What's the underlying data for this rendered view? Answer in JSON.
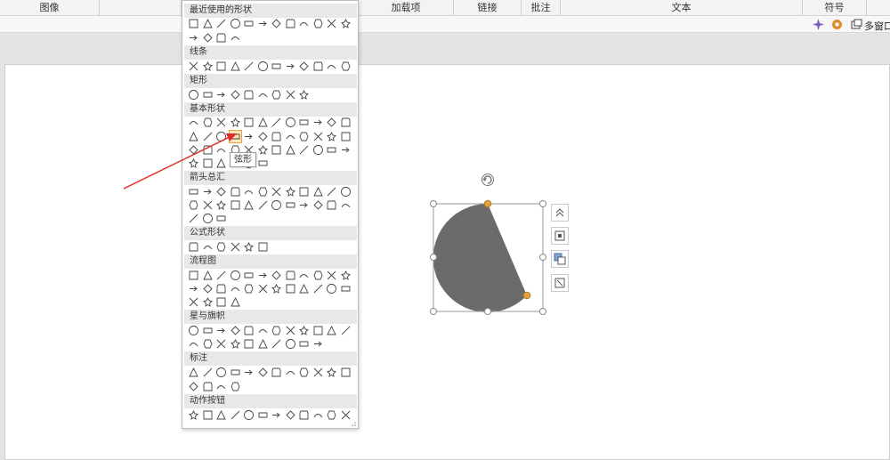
{
  "ribbon": {
    "groups": [
      {
        "id": "image",
        "label": "图像"
      },
      {
        "id": "illust",
        "label": ""
      },
      {
        "id": "addins",
        "label": "加载项"
      },
      {
        "id": "links",
        "label": "链接"
      },
      {
        "id": "comments",
        "label": "批注"
      },
      {
        "id": "text",
        "label": "文本"
      },
      {
        "id": "symbols",
        "label": "符号"
      }
    ],
    "window_label": "多窗口"
  },
  "shapes_panel": {
    "sections": [
      {
        "id": "recent",
        "label": "最近使用的形状"
      },
      {
        "id": "lines",
        "label": "线条"
      },
      {
        "id": "rect",
        "label": "矩形"
      },
      {
        "id": "basic",
        "label": "基本形状"
      },
      {
        "id": "arrows",
        "label": "箭头总汇"
      },
      {
        "id": "equation",
        "label": "公式形状"
      },
      {
        "id": "flowchart",
        "label": "流程图"
      },
      {
        "id": "stars",
        "label": "星与旗帜"
      },
      {
        "id": "callouts",
        "label": "标注"
      },
      {
        "id": "actions",
        "label": "动作按钮"
      }
    ],
    "tooltip": "弦形"
  },
  "colors": {
    "shape_fill": "#6b6b6b",
    "handle_orange": "#e5a23a",
    "arrow_red": "#e02a2a"
  }
}
